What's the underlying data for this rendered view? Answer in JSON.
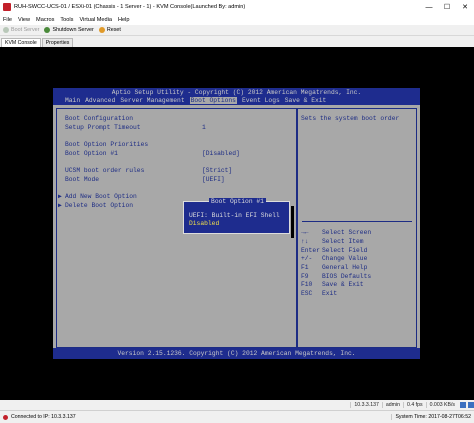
{
  "window": {
    "title": "RUH-SWCC-UCS-01 / ESXi-01 (Chassis - 1 Server - 1) - KVM Console(Launched By: admin)",
    "controls": {
      "minimize": "—",
      "maximize": "☐",
      "close": "✕"
    }
  },
  "menu": [
    "File",
    "View",
    "Macros",
    "Tools",
    "Virtual Media",
    "Help"
  ],
  "toolbar": {
    "boot_server": "Boot Server",
    "shutdown_server": "Shutdown Server",
    "reset": "Reset"
  },
  "tabs": [
    "KVM Console",
    "Properties"
  ],
  "bios": {
    "header_title": "Aptio Setup Utility - Copyright (C) 2012 American Megatrends, Inc.",
    "nav": [
      "Main",
      "Advanced",
      "Server Management",
      "Boot Options",
      "Event Logs",
      "Save & Exit"
    ],
    "active_nav": "Boot Options",
    "rows": {
      "boot_configuration": "Boot Configuration",
      "setup_prompt_timeout": "Setup Prompt Timeout",
      "setup_prompt_timeout_value": "1",
      "boot_option_priorities": "Boot Option Priorities",
      "boot_option_1": "Boot Option #1",
      "boot_option_1_value": "[Disabled]",
      "ucsm_boot_order_rules": "UCSM boot order rules",
      "ucsm_boot_order_rules_value": "[Strict]",
      "boot_mode": "Boot Mode",
      "boot_mode_value": "[UEFI]",
      "add_new_boot_option": "Add New Boot Option",
      "delete_boot_option": "Delete Boot Option"
    },
    "help_text": "Sets the system boot order",
    "keys": [
      {
        "key": "→←",
        "action": "Select Screen"
      },
      {
        "key": "↑↓",
        "action": "Select Item"
      },
      {
        "key": "Enter",
        "action": "Select Field"
      },
      {
        "key": "+/-",
        "action": "Change Value"
      },
      {
        "key": "F1",
        "action": "General Help"
      },
      {
        "key": "F9",
        "action": "BIOS Defaults"
      },
      {
        "key": "F10",
        "action": "Save & Exit"
      },
      {
        "key": "ESC",
        "action": "Exit"
      }
    ],
    "footer": "Version 2.15.1236. Copyright (C) 2012 American Megatrends, Inc.",
    "popup": {
      "title": "Boot Option #1",
      "options": [
        "UEFI: Built-in EFI Shell",
        "Disabled"
      ],
      "highlighted_option": "Disabled"
    }
  },
  "statusbar": {
    "ip": "10.3.3.137",
    "user": "admin",
    "fps": "0.4 fps",
    "kbps": "0.003 KB/s"
  },
  "statusbar2": {
    "connection": "Connected to IP: 10.3.3.137",
    "system_time": "System Time: 2017-08-27T06:52"
  }
}
